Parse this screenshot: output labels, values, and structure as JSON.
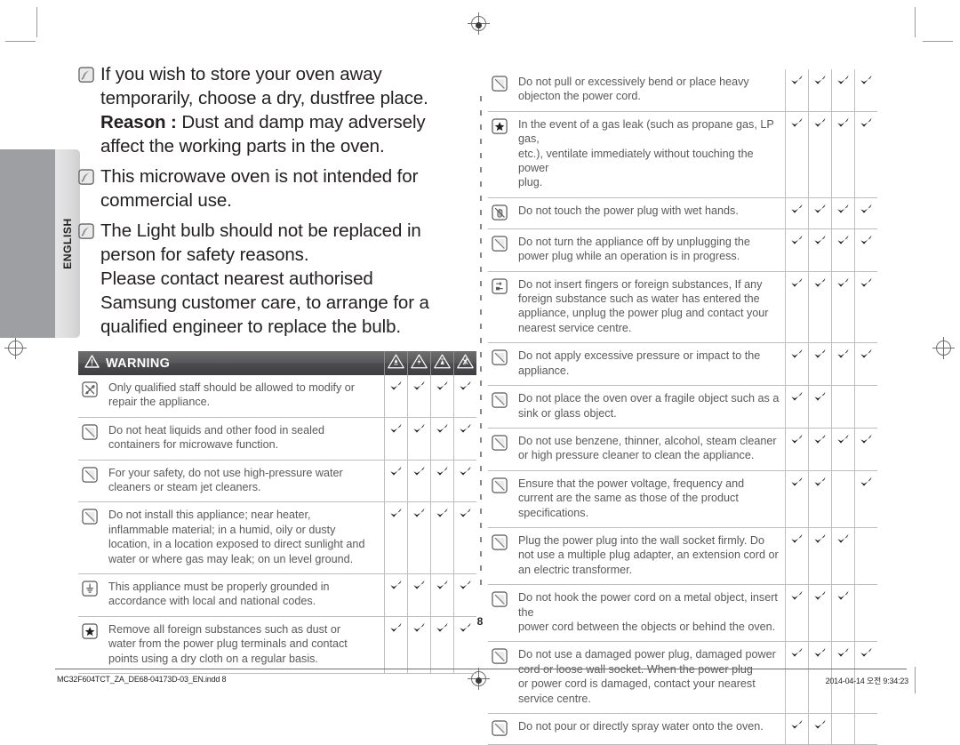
{
  "language_tab": {
    "label": "ENGLISH"
  },
  "page_number": "8",
  "notes": [
    {
      "icon": "note-leaf-icon",
      "lines": [
        {
          "text": "If you wish to store your oven away"
        },
        {
          "text": "temporarily, choose a dry, dustfree place."
        },
        {
          "bold": "Reason : ",
          "text": "Dust and damp may adversely"
        },
        {
          "text": "affect the working parts in the oven."
        }
      ]
    },
    {
      "icon": "note-leaf-icon",
      "lines": [
        {
          "text": "This microwave oven is not intended for"
        },
        {
          "text": "commercial use."
        }
      ]
    },
    {
      "icon": "note-leaf-icon",
      "lines": [
        {
          "text": "The Light bulb should not be replaced in"
        },
        {
          "text": "person for safety reasons."
        },
        {
          "text": "Please contact nearest authorised"
        },
        {
          "text": "Samsung customer care, to arrange for a"
        },
        {
          "text": "qualified engineer to replace the bulb."
        }
      ]
    }
  ],
  "warning_table": {
    "header": {
      "title": "WARNING",
      "warning_icon": "warning-triangle-icon",
      "hazard_columns": [
        "hazard-fire-icon",
        "hazard-electric-shock-icon",
        "hazard-hot-surface-icon",
        "hazard-explosion-icon"
      ]
    },
    "rows": [
      {
        "icon": "prohibition-repair-icon",
        "lines": [
          "Only qualified staff should be allowed to modify or",
          "repair the appliance."
        ],
        "checks": [
          true,
          true,
          true,
          true
        ]
      },
      {
        "icon": "prohibition-icon",
        "lines": [
          "Do not heat liquids and other food in sealed",
          "containers for microwave function."
        ],
        "checks": [
          true,
          true,
          true,
          true
        ]
      },
      {
        "icon": "prohibition-icon",
        "lines": [
          "For your safety, do not use high-pressure water",
          "cleaners or steam jet cleaners."
        ],
        "checks": [
          true,
          true,
          true,
          true
        ]
      },
      {
        "icon": "prohibition-icon",
        "lines": [
          "Do not install this appliance; near heater,",
          "inflammable material; in a humid, oily or dusty",
          "location, in a location exposed to direct sunlight and",
          "water or where gas may leak; on un level ground."
        ],
        "checks": [
          true,
          true,
          true,
          true
        ]
      },
      {
        "icon": "mandatory-ground-icon",
        "lines": [
          "This appliance must be properly grounded in",
          "accordance with local and national codes."
        ],
        "checks": [
          true,
          true,
          true,
          true
        ]
      },
      {
        "icon": "mandatory-star-icon",
        "lines": [
          "Remove all foreign substances such as dust or",
          "water from the power plug terminals and contact",
          "points using a dry cloth on a regular basis."
        ],
        "checks": [
          true,
          true,
          true,
          true
        ]
      }
    ]
  },
  "right_table": {
    "rows": [
      {
        "icon": "prohibition-icon",
        "lines": [
          "Do not pull or excessively bend or place heavy",
          "objecton the power cord."
        ],
        "checks": [
          true,
          true,
          true,
          true
        ]
      },
      {
        "icon": "mandatory-star-icon",
        "lines": [
          "In the event of a gas leak (such as propane gas, LP gas,",
          "etc.), ventilate immediately without touching the power",
          "plug."
        ],
        "checks": [
          true,
          true,
          true,
          true
        ]
      },
      {
        "icon": "prohibition-wet-hands-icon",
        "lines": [
          "Do not touch the power plug with wet hands."
        ],
        "checks": [
          true,
          true,
          true,
          true
        ]
      },
      {
        "icon": "prohibition-icon",
        "lines": [
          "Do not turn the appliance off by unplugging the",
          "power plug while an operation is in progress."
        ],
        "checks": [
          true,
          true,
          true,
          true
        ]
      },
      {
        "icon": "mandatory-unplug-icon",
        "lines": [
          "Do not insert fingers or foreign substances, If any",
          "foreign substance such as water has entered the",
          "appliance, unplug the power plug and contact your",
          "nearest service centre."
        ],
        "checks": [
          true,
          true,
          true,
          true
        ]
      },
      {
        "icon": "prohibition-icon",
        "lines": [
          "Do not apply excessive pressure or impact to the",
          "appliance."
        ],
        "checks": [
          true,
          true,
          true,
          true
        ]
      },
      {
        "icon": "prohibition-icon",
        "lines": [
          "Do not place the oven over a fragile object such as a",
          "sink or glass object."
        ],
        "checks": [
          true,
          true,
          false,
          false
        ]
      },
      {
        "icon": "prohibition-icon",
        "lines": [
          "Do not use benzene, thinner, alcohol, steam cleaner",
          "or high pressure cleaner to clean the appliance."
        ],
        "checks": [
          true,
          true,
          true,
          true
        ]
      },
      {
        "icon": "prohibition-icon",
        "lines": [
          "Ensure that the power voltage, frequency and",
          "current are the same as those of the product",
          "specifications."
        ],
        "checks": [
          true,
          true,
          false,
          true
        ]
      },
      {
        "icon": "prohibition-icon",
        "lines": [
          "Plug the power plug into the wall socket firmly. Do",
          "not use a multiple plug adapter, an extension cord or",
          "an electric transformer."
        ],
        "checks": [
          true,
          true,
          true,
          false
        ]
      },
      {
        "icon": "prohibition-icon",
        "lines": [
          "Do not hook the power cord on a metal object, insert the",
          "power cord between the objects or behind the oven."
        ],
        "checks": [
          true,
          true,
          true,
          false
        ]
      },
      {
        "icon": "prohibition-icon",
        "lines": [
          "Do not use a damaged power plug, damaged power",
          "cord or loose wall socket. When the power plug",
          "or power cord is damaged, contact your nearest",
          "service centre."
        ],
        "checks": [
          true,
          true,
          true,
          true
        ]
      },
      {
        "icon": "prohibition-icon",
        "lines": [
          "Do not pour or directly spray water onto the oven."
        ],
        "checks": [
          true,
          true,
          false,
          false
        ]
      }
    ]
  },
  "footer": {
    "file_name": "MC32F604TCT_ZA_DE68-04173D-03_EN.indd   8",
    "timestamp": "2014-04-14   오전 9:34:23"
  }
}
